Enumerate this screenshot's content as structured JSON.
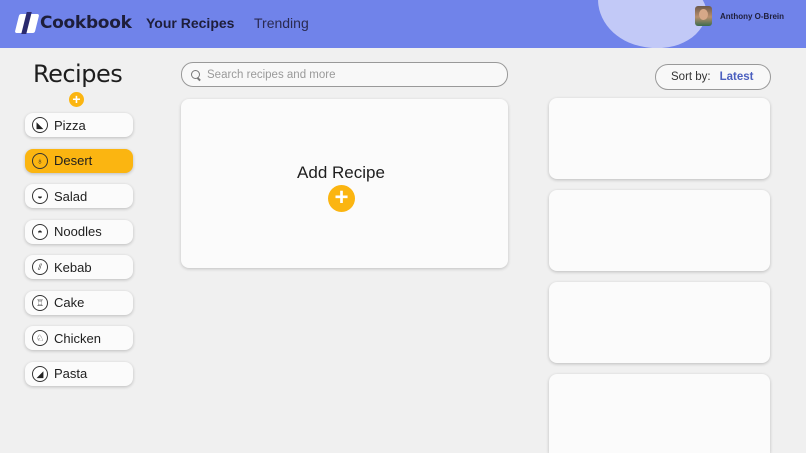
{
  "header": {
    "app_name": "Cookbook",
    "nav": [
      {
        "label": "Your Recipes",
        "active": true
      },
      {
        "label": "Trending",
        "active": false
      }
    ],
    "user": {
      "name": "Anthony O-Brein",
      "avatar": "user-photo"
    }
  },
  "sidebar": {
    "title": "Recipes",
    "add_icon": "+",
    "categories": [
      {
        "label": "Pizza",
        "icon": "pizza-icon",
        "glyph": "◣",
        "active": false
      },
      {
        "label": "Desert",
        "icon": "ice-cream-icon",
        "glyph": "♁",
        "active": true
      },
      {
        "label": "Salad",
        "icon": "salad-bowl-icon",
        "glyph": "◒",
        "active": false
      },
      {
        "label": "Noodles",
        "icon": "noodle-bowl-icon",
        "glyph": "◓",
        "active": false
      },
      {
        "label": "Kebab",
        "icon": "kebab-skewer-icon",
        "glyph": "⫽",
        "active": false
      },
      {
        "label": "Cake",
        "icon": "cake-icon",
        "glyph": "♖",
        "active": false
      },
      {
        "label": "Chicken",
        "icon": "chicken-icon",
        "glyph": "♘",
        "active": false
      },
      {
        "label": "Pasta",
        "icon": "pasta-plate-icon",
        "glyph": "◢",
        "active": false
      }
    ]
  },
  "search": {
    "placeholder": "Search recipes and more",
    "value": ""
  },
  "sort": {
    "label": "Sort by:",
    "value": "Latest"
  },
  "add_card": {
    "title": "Add Recipe",
    "button_icon": "+"
  },
  "colors": {
    "header": "#7083ea",
    "accent": "#fbb511",
    "sort_value": "#4b5fbf",
    "background": "#f0f0f0"
  }
}
